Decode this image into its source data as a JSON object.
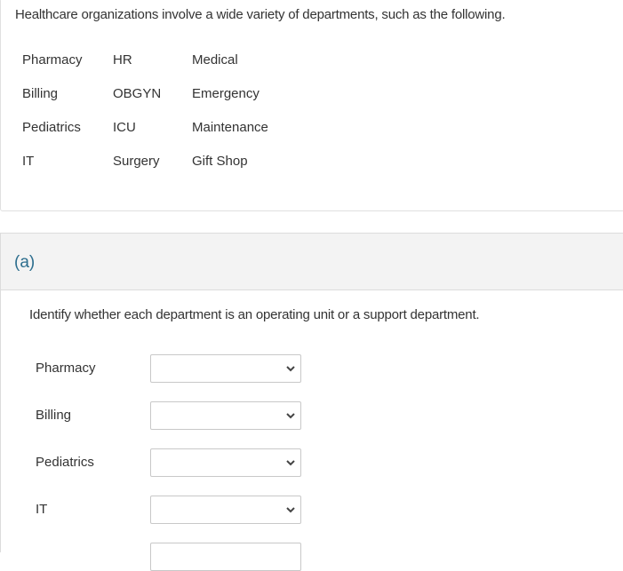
{
  "intro_text": "Healthcare organizations involve a wide variety of departments, such as the following.",
  "departments": [
    [
      "Pharmacy",
      "HR",
      "Medical"
    ],
    [
      "Billing",
      "OBGYN",
      "Emergency"
    ],
    [
      "Pediatrics",
      "ICU",
      "Maintenance"
    ],
    [
      "IT",
      "Surgery",
      "Gift Shop"
    ]
  ],
  "part": {
    "label": "(a)",
    "question": "Identify whether each department is an operating unit or a support department.",
    "rows": [
      {
        "department": "Pharmacy",
        "selected": ""
      },
      {
        "department": "Billing",
        "selected": ""
      },
      {
        "department": "Pediatrics",
        "selected": ""
      },
      {
        "department": "IT",
        "selected": ""
      }
    ],
    "dropdown_icon": "chevron-down-icon"
  },
  "colors": {
    "part_label": "#2d6e8e",
    "header_bg": "#f3f3f3",
    "border": "#dcdcdc"
  }
}
